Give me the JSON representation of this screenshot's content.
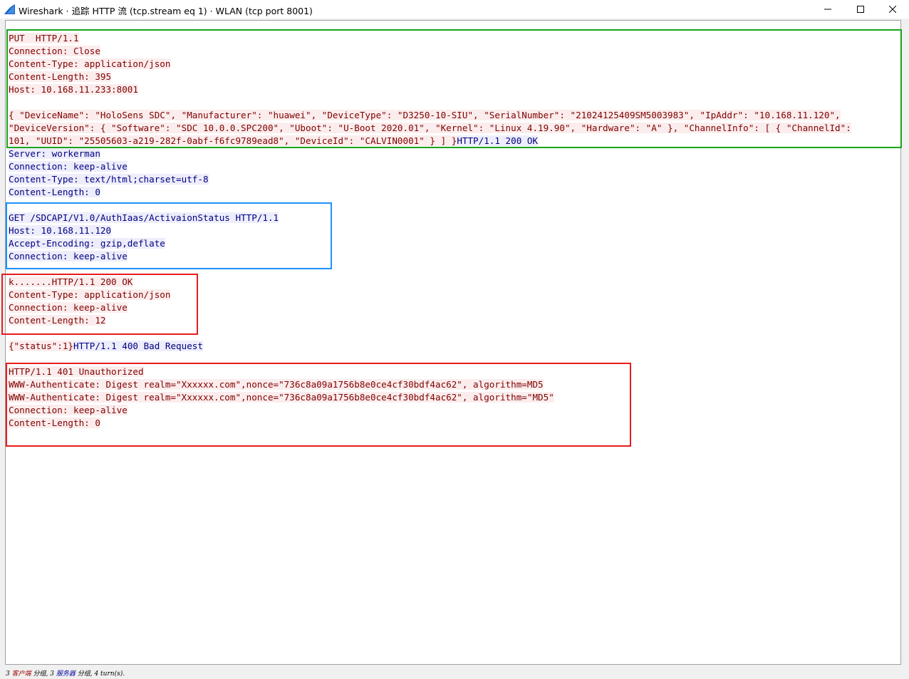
{
  "window": {
    "title": "Wireshark · 追踪 HTTP 流 (tcp.stream eq 1) · WLAN (tcp port 8001)",
    "controls": [
      "minimize-icon",
      "maximize-icon",
      "close-icon"
    ]
  },
  "colors": {
    "client_text": "#800000",
    "client_bg": "#fbeded",
    "server_text": "#000080",
    "server_bg": "#ededfb",
    "annotation_green": "#1aa31a",
    "annotation_blue": "#1e90ff",
    "annotation_red": "#e81c1c"
  },
  "stream": {
    "lines": [
      [
        {
          "dir": "client",
          "text": "PUT  HTTP/1.1"
        }
      ],
      [
        {
          "dir": "client",
          "text": "Connection: Close"
        }
      ],
      [
        {
          "dir": "client",
          "text": "Content-Type: application/json"
        }
      ],
      [
        {
          "dir": "client",
          "text": "Content-Length: 395"
        }
      ],
      [
        {
          "dir": "client",
          "text": "Host: 10.168.11.233:8001"
        }
      ],
      [],
      [
        {
          "dir": "client",
          "text": "{ \"DeviceName\": \"HoloSens SDC\", \"Manufacturer\": \"huawei\", \"DeviceType\": \"D3250-10-SIU\", \"SerialNumber\": \"21024125409SM5003983\", \"IpAddr\": \"10.168.11.120\","
        }
      ],
      [
        {
          "dir": "client",
          "text": "\"DeviceVersion\": { \"Software\": \"SDC 10.0.0.SPC200\", \"Uboot\": \"U-Boot 2020.01\", \"Kernel\": \"Linux 4.19.90\", \"Hardware\": \"A\" }, \"ChannelInfo\": [ { \"ChannelId\":"
        }
      ],
      [
        {
          "dir": "client",
          "text": "101, \"UUID\": \"25505603-a219-282f-0abf-f6fc9789ead8\", \"DeviceId\": \"CALVIN0001\" } ] }"
        },
        {
          "dir": "server",
          "text": "HTTP/1.1 200 OK"
        }
      ],
      [
        {
          "dir": "server",
          "text": "Server: workerman"
        }
      ],
      [
        {
          "dir": "server",
          "text": "Connection: keep-alive"
        }
      ],
      [
        {
          "dir": "server",
          "text": "Content-Type: text/html;charset=utf-8"
        }
      ],
      [
        {
          "dir": "server",
          "text": "Content-Length: 0"
        }
      ],
      [],
      [
        {
          "dir": "server",
          "text": "GET /SDCAPI/V1.0/AuthIaas/ActivaionStatus HTTP/1.1"
        }
      ],
      [
        {
          "dir": "server",
          "text": "Host: 10.168.11.120"
        }
      ],
      [
        {
          "dir": "server",
          "text": "Accept-Encoding: gzip,deflate"
        }
      ],
      [
        {
          "dir": "server",
          "text": "Connection: keep-alive"
        }
      ],
      [],
      [
        {
          "dir": "client",
          "text": "k.......HTTP/1.1 200 OK"
        }
      ],
      [
        {
          "dir": "client",
          "text": "Content-Type: application/json"
        }
      ],
      [
        {
          "dir": "client",
          "text": "Connection: keep-alive"
        }
      ],
      [
        {
          "dir": "client",
          "text": "Content-Length: 12"
        }
      ],
      [],
      [
        {
          "dir": "client",
          "text": "{\"status\":1}"
        },
        {
          "dir": "server",
          "text": "HTTP/1.1 400 Bad Request"
        }
      ],
      [],
      [
        {
          "dir": "client",
          "text": "HTTP/1.1 401 Unauthorized"
        }
      ],
      [
        {
          "dir": "client",
          "text": "WWW-Authenticate: Digest realm=\"Xxxxxx.com\",nonce=\"736c8a09a1756b8e0ce4cf30bdf4ac62\", algorithm=MD5"
        }
      ],
      [
        {
          "dir": "client",
          "text": "WWW-Authenticate: Digest realm=\"Xxxxxx.com\",nonce=\"736c8a09a1756b8e0ce4cf30bdf4ac62\", algorithm=\"MD5\""
        }
      ],
      [
        {
          "dir": "client",
          "text": "Connection: keep-alive"
        }
      ],
      [
        {
          "dir": "client",
          "text": "Content-Length: 0"
        }
      ]
    ]
  },
  "status": {
    "count1": "3",
    "client_word": "客户端",
    "packets_word1": "分组, ",
    "count2": "3",
    "server_word": "服务器",
    "packets_word2": "分组, ",
    "turns": "4 turn(s)."
  }
}
